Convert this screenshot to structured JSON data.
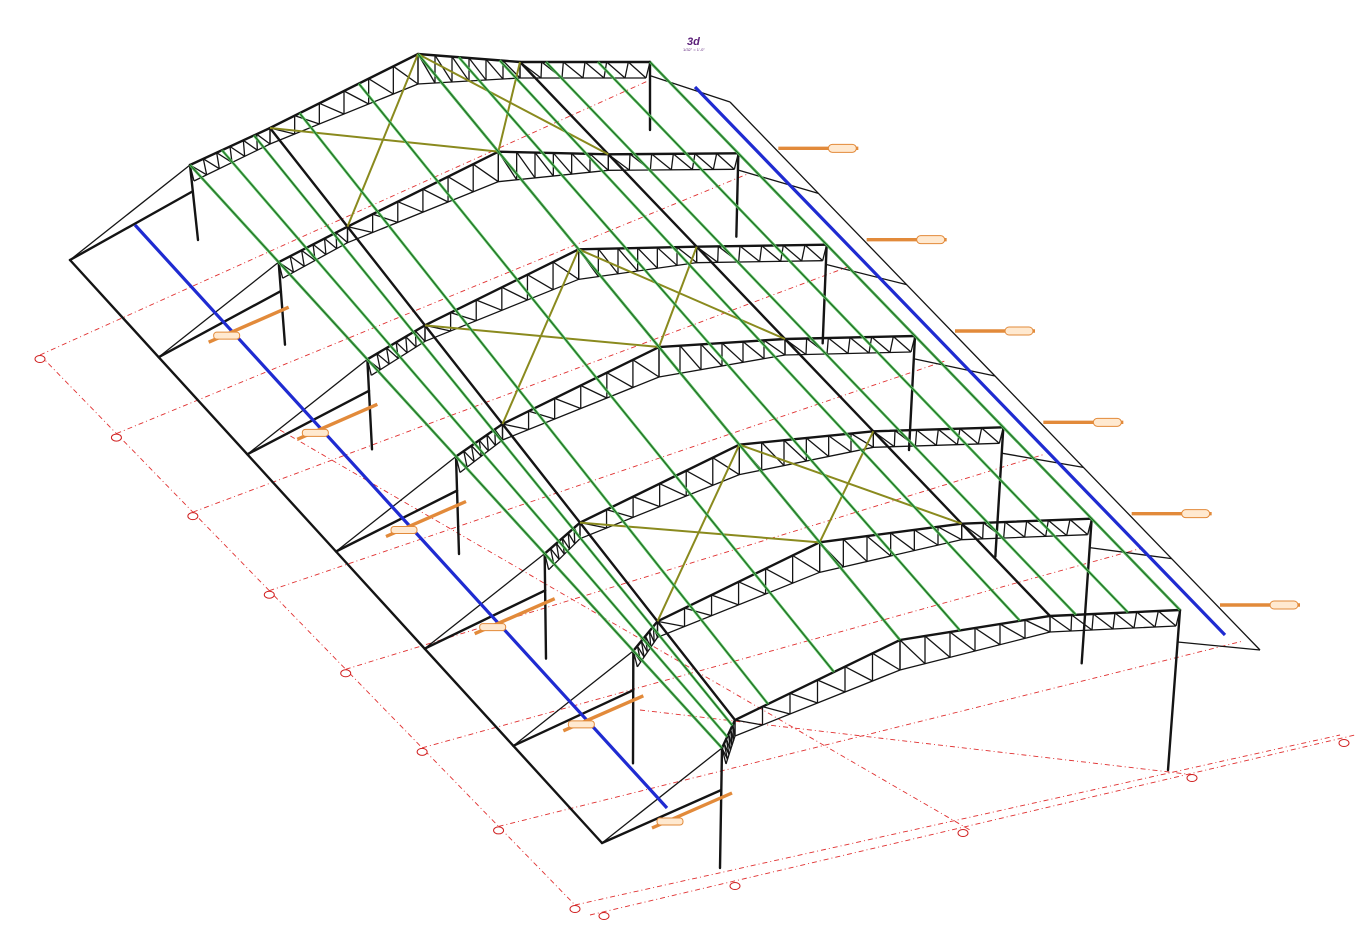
{
  "view": {
    "title": "3d",
    "subtitle": "1/32\" = 1'-0\""
  },
  "colors": {
    "background": "#ffffff",
    "structure": "#141414",
    "purlins": "#52c45a",
    "bracing": "#8a8a1e",
    "eave_struts": "#1f2bd1",
    "grid_lines": "#e03030",
    "ties": "#e28a3a"
  },
  "model": {
    "type": "pre-engineered steel truss roof building, isometric 3D view",
    "frame_count": 7,
    "purlin_rows": 11
  },
  "icons": [
    "grid-bubble-icon",
    "tag-icon"
  ]
}
